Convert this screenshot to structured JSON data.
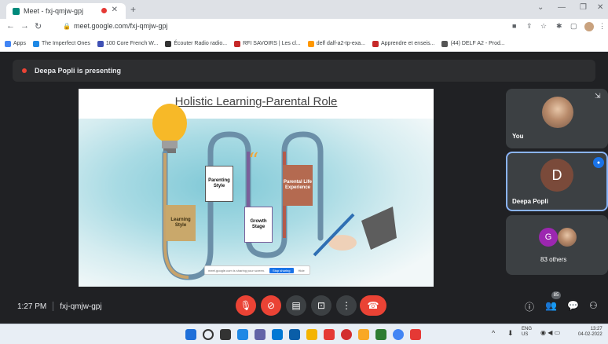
{
  "browser": {
    "tab_title": "Meet - fxj-qmjw-gpj",
    "url": "meet.google.com/fxj-qmjw-gpj",
    "bookmarks": [
      {
        "label": "Apps",
        "color": "#4285f4"
      },
      {
        "label": "The Imperfect Ones",
        "color": "#1e88e5"
      },
      {
        "label": "100 Core French W...",
        "color": "#3f51b5"
      },
      {
        "label": "Écouter Radio radio...",
        "color": "#333333"
      },
      {
        "label": "RFI SAVOIRS | Les cl...",
        "color": "#c62828"
      },
      {
        "label": "delf dalf-a2-tp-exa...",
        "color": "#ff9800"
      },
      {
        "label": "Apprendre et enseis...",
        "color": "#c62828"
      },
      {
        "label": "(44) DELF A2 - Prod...",
        "color": "#555555"
      }
    ]
  },
  "meet": {
    "presenting_text": "Deepa Popli is presenting",
    "meeting_time": "1:27 PM",
    "meeting_code": "fxj-qmjw-gpj",
    "participants": {
      "self_label": "You",
      "speaker_initial": "D",
      "speaker_name": "Deepa Popli",
      "others_initial": "G",
      "others_label": "83 others"
    },
    "people_count_badge": "85"
  },
  "slide": {
    "title": "Holistic Learning-Parental Role",
    "boxes": {
      "learning": "Learning Style",
      "parenting": "Parenting Style",
      "growth": "Growth Stage",
      "experience": "Parental Life Experience"
    },
    "mini_share": {
      "url_text": "meet.google.com is sharing your screen.",
      "stop_label": "Stop sharing",
      "hide_label": "Hide"
    }
  },
  "system": {
    "lang": "ENG",
    "region": "US",
    "clock_time": "13:27",
    "clock_date": "04-02-2022"
  },
  "colors": {
    "end_call": "#ea4335",
    "meet_bg": "#202124",
    "tile_bg": "#3c4043",
    "accent_blue": "#1a73e8"
  }
}
